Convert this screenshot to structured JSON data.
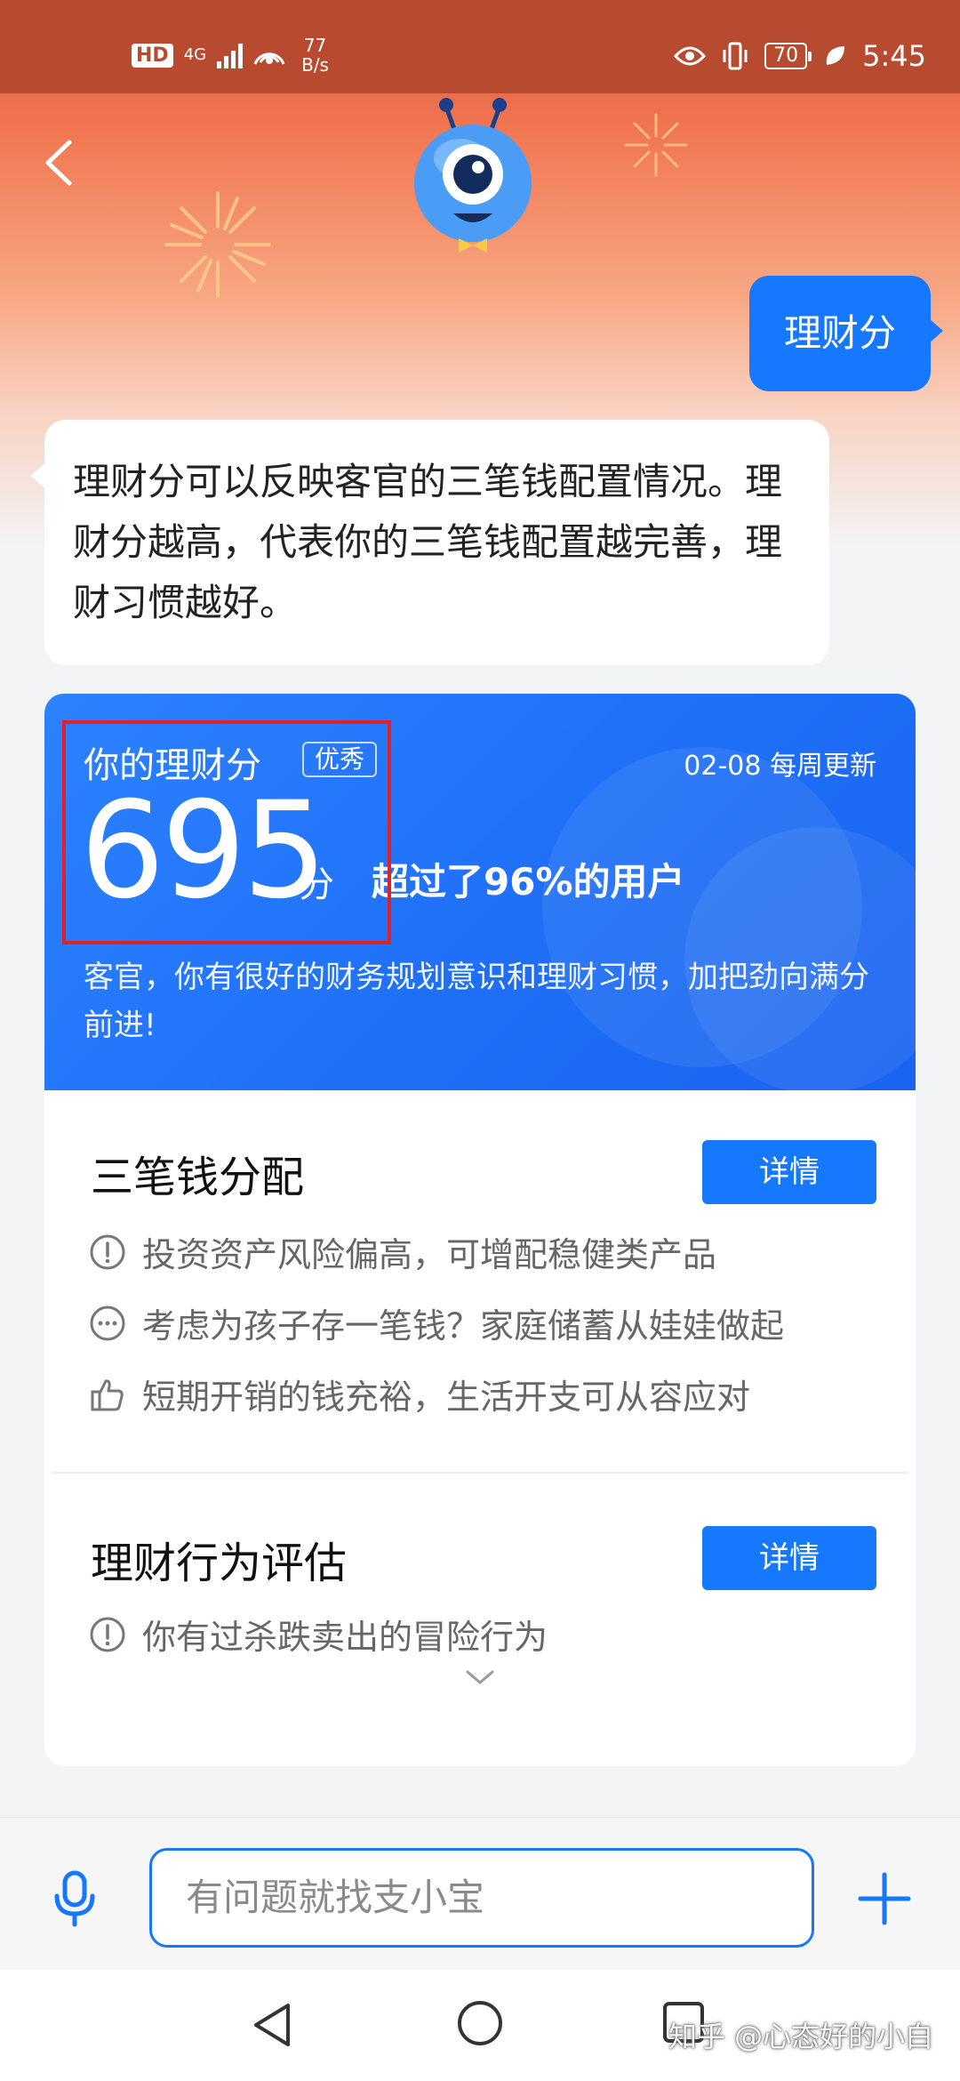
{
  "status_bar": {
    "hd": "HD",
    "network": "4G",
    "speed_value": "77",
    "speed_unit": "B/s",
    "battery": "70",
    "time": "5:45"
  },
  "chat": {
    "user_message": "理财分",
    "bot_message": "理财分可以反映客官的三笔钱配置情况。理财分越高，代表你的三笔钱配置越完善，理财习惯越好。"
  },
  "score_card": {
    "title": "你的理财分",
    "badge": "优秀",
    "update": "02-08 每周更新",
    "score": "695",
    "unit": "分",
    "exceed": "超过了96%的用户",
    "description": "客官，你有很好的财务规划意识和理财习惯，加把劲向满分前进!"
  },
  "allocation": {
    "title": "三笔钱分配",
    "button": "详情",
    "tips": [
      {
        "icon": "exclamation-circle-icon",
        "text": "投资资产风险偏高，可增配稳健类产品"
      },
      {
        "icon": "ellipsis-circle-icon",
        "text": "考虑为孩子存一笔钱？家庭储蓄从娃娃做起"
      },
      {
        "icon": "thumbs-up-icon",
        "text": "短期开销的钱充裕，生活开支可从容应对"
      }
    ]
  },
  "behavior": {
    "title": "理财行为评估",
    "button": "详情",
    "tips": [
      {
        "icon": "exclamation-circle-icon",
        "text": "你有过杀跌卖出的冒险行为"
      }
    ]
  },
  "input_bar": {
    "placeholder": "有问题就找支小宝"
  },
  "watermark": "知乎 @心态好的小白",
  "colors": {
    "accent": "#1677ff",
    "header_red": "#b84a30",
    "highlight": "#e32028"
  }
}
